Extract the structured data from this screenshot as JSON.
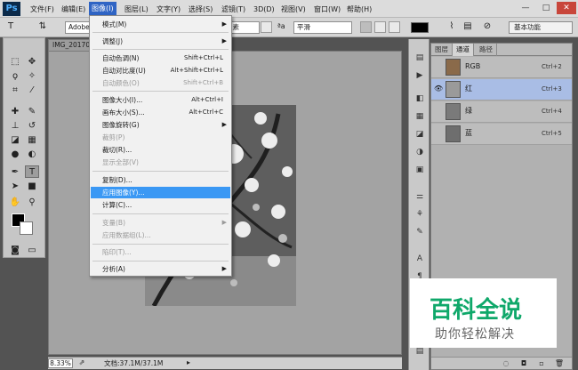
{
  "app": {
    "logo": "Ps"
  },
  "menubar": {
    "items": [
      "文件(F)",
      "编辑(E)",
      "图像(I)",
      "图层(L)",
      "文字(Y)",
      "选择(S)",
      "滤镜(T)",
      "3D(D)",
      "视图(V)",
      "窗口(W)",
      "帮助(H)"
    ],
    "active_index": 2,
    "window_controls": [
      "—",
      "□",
      "✕"
    ]
  },
  "options": {
    "font_family": "Adobe ...",
    "size_unit": "像素",
    "aa_icon": "ªa",
    "antialias": "平滑",
    "workspace": "基本功能"
  },
  "document": {
    "tab_title": "IMG_20170...",
    "zoom": "8.33%",
    "doc_size": "文档:37.1M/37.1M"
  },
  "image_menu": {
    "items": [
      {
        "label": "模式(M)",
        "shortcut": "",
        "submenu": true,
        "disabled": false
      },
      {
        "label": "调整(J)",
        "shortcut": "",
        "submenu": true,
        "disabled": false
      },
      {
        "label": "自动色调(N)",
        "shortcut": "Shift+Ctrl+L",
        "submenu": false,
        "disabled": false
      },
      {
        "label": "自动对比度(U)",
        "shortcut": "Alt+Shift+Ctrl+L",
        "submenu": false,
        "disabled": false
      },
      {
        "label": "自动颜色(O)",
        "shortcut": "Shift+Ctrl+B",
        "submenu": false,
        "disabled": true
      },
      {
        "label": "图像大小(I)...",
        "shortcut": "Alt+Ctrl+I",
        "submenu": false,
        "disabled": false
      },
      {
        "label": "画布大小(S)...",
        "shortcut": "Alt+Ctrl+C",
        "submenu": false,
        "disabled": false
      },
      {
        "label": "图像旋转(G)",
        "shortcut": "",
        "submenu": true,
        "disabled": false
      },
      {
        "label": "裁剪(P)",
        "shortcut": "",
        "submenu": false,
        "disabled": true
      },
      {
        "label": "裁切(R)...",
        "shortcut": "",
        "submenu": false,
        "disabled": false
      },
      {
        "label": "显示全部(V)",
        "shortcut": "",
        "submenu": false,
        "disabled": true
      },
      {
        "label": "复制(D)...",
        "shortcut": "",
        "submenu": false,
        "disabled": false
      },
      {
        "label": "应用图像(Y)...",
        "shortcut": "",
        "submenu": false,
        "disabled": false,
        "highlighted": true
      },
      {
        "label": "计算(C)...",
        "shortcut": "",
        "submenu": false,
        "disabled": false
      },
      {
        "label": "变量(B)",
        "shortcut": "",
        "submenu": true,
        "disabled": true
      },
      {
        "label": "应用数据组(L)...",
        "shortcut": "",
        "submenu": false,
        "disabled": true
      },
      {
        "label": "陷印(T)...",
        "shortcut": "",
        "submenu": false,
        "disabled": true
      },
      {
        "label": "分析(A)",
        "shortcut": "",
        "submenu": true,
        "disabled": false
      }
    ]
  },
  "panel": {
    "tabs": [
      "图层",
      "通道",
      "路径"
    ],
    "active_tab": 1,
    "channels": [
      {
        "name": "RGB",
        "shortcut": "Ctrl+2",
        "visible": false,
        "selected": false
      },
      {
        "name": "红",
        "shortcut": "Ctrl+3",
        "visible": true,
        "selected": true
      },
      {
        "name": "绿",
        "shortcut": "Ctrl+4",
        "visible": false,
        "selected": false
      },
      {
        "name": "蓝",
        "shortcut": "Ctrl+5",
        "visible": false,
        "selected": false
      }
    ]
  },
  "watermark": {
    "main": "百科全说",
    "sub": "助你轻松解决"
  },
  "colors": {
    "foreground": "#000000",
    "background": "#ffffff",
    "highlight": "#3a98f4",
    "selected_channel": "#a9bde5",
    "watermark_green": "#0fa86a"
  }
}
